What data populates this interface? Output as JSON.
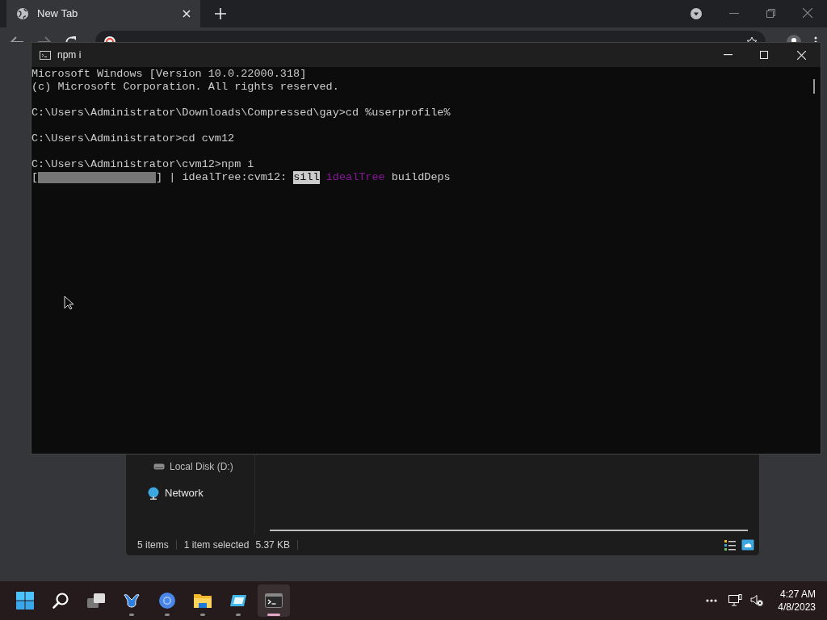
{
  "browser": {
    "tab": {
      "title": "New Tab",
      "selected": true
    }
  },
  "terminal": {
    "title": "npm i",
    "lines": [
      {
        "kind": "text",
        "text": "Microsoft Windows [Version 10.0.22000.318]"
      },
      {
        "kind": "text",
        "text": "(c) Microsoft Corporation. All rights reserved."
      },
      {
        "kind": "blank"
      },
      {
        "kind": "text",
        "text": "C:\\Users\\Administrator\\Downloads\\Compressed\\gay>cd %userprofile%"
      },
      {
        "kind": "blank"
      },
      {
        "kind": "text",
        "text": "C:\\Users\\Administrator>cd cvm12"
      },
      {
        "kind": "blank"
      },
      {
        "kind": "text",
        "text": "C:\\Users\\Administrator\\cvm12>npm i"
      },
      {
        "kind": "progress",
        "open": "[",
        "close": "]",
        "level": 1,
        "segments": [
          {
            "kind": "plain",
            "text": " | idealTree:cvm12: "
          },
          {
            "kind": "highlight",
            "text": "sill"
          },
          {
            "kind": "magenta",
            "text": " idealTree"
          },
          {
            "kind": "plain",
            "text": " buildDeps"
          }
        ]
      }
    ]
  },
  "explorer": {
    "nav": [
      {
        "kind": "drive",
        "label": "Local Disk (D:)"
      },
      {
        "kind": "network",
        "label": "Network"
      }
    ],
    "status": [
      "5 items",
      "1 item selected",
      "5.37 KB"
    ]
  },
  "taskbar": {
    "apps": [
      {
        "kind": "start",
        "selected": false
      },
      {
        "kind": "search",
        "selected": false
      },
      {
        "kind": "taskview",
        "selected": false
      },
      {
        "kind": "app-blue",
        "selected": false,
        "running": true
      },
      {
        "kind": "browser",
        "selected": false,
        "running": true
      },
      {
        "kind": "folder",
        "selected": false,
        "running": true
      },
      {
        "kind": "app-cyan",
        "selected": false,
        "running": true
      },
      {
        "kind": "terminal",
        "selected": true,
        "running": true
      }
    ],
    "time": "4:27 AM",
    "date": "4/8/2023"
  }
}
